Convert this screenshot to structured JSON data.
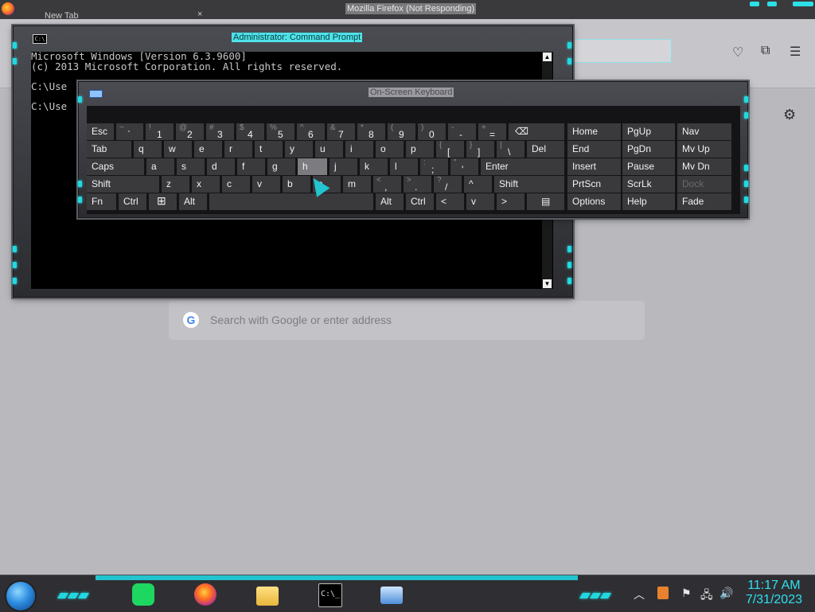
{
  "firefox": {
    "window_title": "Mozilla Firefox (Not Responding)",
    "tab_label": "New Tab",
    "tab_close": "×",
    "search_placeholder": "Search with Google or enter address",
    "google_letter": "G",
    "pocket_icon": "♡",
    "extensions_icon": "⧉",
    "menu_icon": "☰",
    "settings_icon": "⚙"
  },
  "cmd": {
    "title": "Administrator: Command Prompt",
    "icon_text": "C:\\",
    "lines": [
      "Microsoft Windows [Version 6.3.9600]",
      "(c) 2013 Microsoft Corporation. All rights reserved.",
      "",
      "C:\\Use",
      "",
      "C:\\Use"
    ],
    "scroll_up": "▲",
    "scroll_down": "▼"
  },
  "osk": {
    "title": "On-Screen Keyboard",
    "row1": {
      "esc": "Esc",
      "k1": {
        "sym": "!",
        "main": "1"
      },
      "k2": {
        "sym": "@",
        "main": "2"
      },
      "k3": {
        "sym": "#",
        "main": "3"
      },
      "k4": {
        "sym": "$",
        "main": "4"
      },
      "k5": {
        "sym": "%",
        "main": "5"
      },
      "k6": {
        "sym": "^",
        "main": "6"
      },
      "k7": {
        "sym": "&",
        "main": "7"
      },
      "k8": {
        "sym": "*",
        "main": "8"
      },
      "k9": {
        "sym": "(",
        "main": "9"
      },
      "k0": {
        "sym": ")",
        "main": "0"
      },
      "minus": {
        "sym": "-",
        "main": "-"
      },
      "equal": {
        "sym": "+",
        "main": "="
      },
      "tilde": {
        "sym": "~",
        "main": "`"
      },
      "backspace": "⌫"
    },
    "row2": {
      "tab": "Tab",
      "q": "q",
      "w": "w",
      "e": "e",
      "r": "r",
      "t": "t",
      "y": "y",
      "u": "u",
      "i": "i",
      "o": "o",
      "p": "p",
      "lbr": {
        "sym": "{",
        "main": "["
      },
      "rbr": {
        "sym": "}",
        "main": "]"
      },
      "bslash": {
        "sym": "|",
        "main": "\\"
      },
      "del": "Del"
    },
    "row3": {
      "caps": "Caps",
      "a": "a",
      "s": "s",
      "d": "d",
      "f": "f",
      "g": "g",
      "h": "h",
      "j": "j",
      "k": "k",
      "l": "l",
      "semi": {
        "sym": ":",
        "main": ";"
      },
      "quote": {
        "sym": "\"",
        "main": "'"
      },
      "enter": "Enter"
    },
    "row4": {
      "shift": "Shift",
      "z": "z",
      "x": "x",
      "c": "c",
      "v": "v",
      "b": "b",
      "n": "n",
      "m": "m",
      "comma": {
        "sym": "<",
        "main": ","
      },
      "period": {
        "sym": ">",
        "main": "."
      },
      "slash": {
        "sym": "?",
        "main": "/"
      },
      "up": "^",
      "shift_r": "Shift"
    },
    "row5": {
      "fn": "Fn",
      "ctrl": "Ctrl",
      "win": "⊞",
      "alt": "Alt",
      "alt_r": "Alt",
      "ctrl_r": "Ctrl",
      "left": "<",
      "down": "v",
      "right": ">",
      "menu": "▤"
    },
    "nav": {
      "home": "Home",
      "pgup": "PgUp",
      "nav": "Nav",
      "end": "End",
      "pgdn": "PgDn",
      "mvup": "Mv Up",
      "insert": "Insert",
      "pause": "Pause",
      "mvdn": "Mv Dn",
      "prtscn": "PrtScn",
      "scrlk": "ScrLk",
      "dock": "Dock",
      "options": "Options",
      "help": "Help",
      "fade": "Fade"
    }
  },
  "taskbar": {
    "time": "11:17 AM",
    "date": "7/31/2023",
    "cmd_icon_text": "C:\\_",
    "tray_up": "︿",
    "flag_icon": "⚑",
    "network_icon": "🖧",
    "volume_icon": "🔊"
  },
  "colors": {
    "accent": "#22d8e0",
    "key": "#3a3a3d",
    "key_highlight": "#7b7b80"
  }
}
